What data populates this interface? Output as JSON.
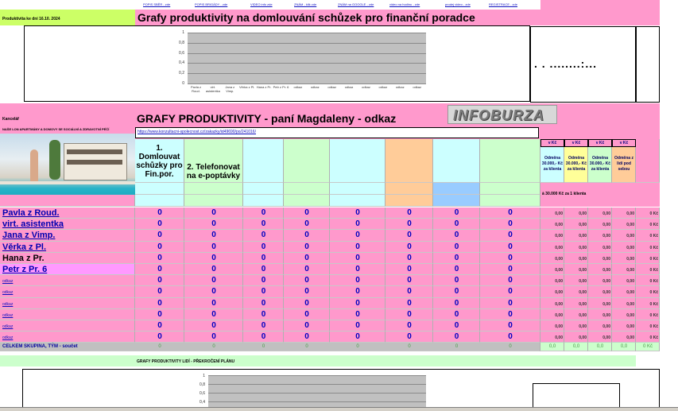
{
  "top_links": [
    "POPIS SBĚR - zde",
    "POPIS BRIGÁDY - zde",
    "VIDEO info zde",
    "ZNÁM - klik zde",
    "ZNÁM na GOOGLE - zde",
    "video na hodinu - zde",
    "prodej video - zde",
    "REGISTRACE - zde"
  ],
  "date_label": "Produktivita ke dni 16.10. 2024",
  "title_top": "Grafy produktivity na domlouvání schůzek pro finanční poradce",
  "top_chart": {
    "y_ticks": [
      "1",
      "0,8",
      "0,6",
      "0,4",
      "0,2",
      "0"
    ],
    "x_labels": [
      "Pavla z Roud.",
      "virt. asistentka",
      "Jana z Vimp.",
      "Věrka z Pl.",
      "Hana z Pr.",
      "Petr z Pr. 6",
      "odkaz",
      "odkaz",
      "odkaz",
      "odkaz",
      "odkaz",
      "odkaz",
      "odkaz",
      "odkaz"
    ]
  },
  "dots_text": ". . ........:...",
  "kancelar_label": "Kancelář",
  "subtitle": "GRAFY  PRODUKTIVITY  - paní Magdaleny - odkaz",
  "logo_text": "INFOBURZA",
  "ad_text": "NAŠE LON APARTMÁNY A DOMOVY SE SOCIÁLNÍ A ZDRAVOTNÍ PÉČÍ",
  "url_text": "https://www.konzultacni-spolecnost.cz/zakazky/id49690/po/241016/",
  "columns": [
    "1. Domlouvat schůzky pro Fin.por.",
    "2. Telefonovat na e-poptávky"
  ],
  "vkc": [
    "v Kč",
    "v Kč",
    "v Kč",
    "v Kč"
  ],
  "odmena": [
    "Odměna 30.000,- Kč za klienta",
    "Odměna 30.000,- Kč za klienta",
    "Odměna 30.000,- Kč za klienta",
    "Odměna z lidí pod sebou"
  ],
  "note_30000": "à 30.000 Kč za 1 klienta",
  "rows": [
    {
      "name": "Pavla z Roud.",
      "vals": [
        "0",
        "0",
        "0",
        "0",
        "0",
        "0",
        "0",
        "0"
      ],
      "money": [
        "0,00",
        "0,00",
        "0,00",
        "0,00",
        "0 Kč"
      ]
    },
    {
      "name": "virt. asistentka",
      "vals": [
        "0",
        "0",
        "0",
        "0",
        "0",
        "0",
        "0",
        "0"
      ],
      "money": [
        "0,00",
        "0,00",
        "0,00",
        "0,00",
        "0 Kč"
      ]
    },
    {
      "name": "Jana z Vimp.",
      "vals": [
        "0",
        "0",
        "0",
        "0",
        "0",
        "0",
        "0",
        "0"
      ],
      "money": [
        "0,00",
        "0,00",
        "0,00",
        "0,00",
        "0 Kč"
      ]
    },
    {
      "name": "Věrka z Pl.",
      "vals": [
        "0",
        "0",
        "0",
        "0",
        "0",
        "0",
        "0",
        "0"
      ],
      "money": [
        "0,00",
        "0,00",
        "0,00",
        "0,00",
        "0 Kč"
      ]
    },
    {
      "name": "Hana z Pr.",
      "vals": [
        "0",
        "0",
        "0",
        "0",
        "0",
        "0",
        "0",
        "0"
      ],
      "money": [
        "0,00",
        "0,00",
        "0,00",
        "0,00",
        "0 Kč"
      ]
    },
    {
      "name": "Petr z Pr. 6",
      "vals": [
        "0",
        "0",
        "0",
        "0",
        "0",
        "0",
        "0",
        "0"
      ],
      "money": [
        "0,00",
        "0,00",
        "0,00",
        "0,00",
        "0 Kč"
      ]
    },
    {
      "name": "odkaz",
      "vals": [
        "0",
        "0",
        "0",
        "0",
        "0",
        "0",
        "0",
        "0"
      ],
      "money": [
        "0,00",
        "0,00",
        "0,00",
        "0,00",
        "0 Kč"
      ]
    },
    {
      "name": "odkaz",
      "vals": [
        "0",
        "0",
        "0",
        "0",
        "0",
        "0",
        "0",
        "0"
      ],
      "money": [
        "0,00",
        "0,00",
        "0,00",
        "0,00",
        "0 Kč"
      ]
    },
    {
      "name": "odkaz",
      "vals": [
        "0",
        "0",
        "0",
        "0",
        "0",
        "0",
        "0",
        "0"
      ],
      "money": [
        "0,00",
        "0,00",
        "0,00",
        "0,00",
        "0 Kč"
      ]
    },
    {
      "name": "odkaz",
      "vals": [
        "0",
        "0",
        "0",
        "0",
        "0",
        "0",
        "0",
        "0"
      ],
      "money": [
        "0,00",
        "0,00",
        "0,00",
        "0,00",
        "0 Kč"
      ]
    },
    {
      "name": "odkaz",
      "vals": [
        "0",
        "0",
        "0",
        "0",
        "0",
        "0",
        "0",
        "0"
      ],
      "money": [
        "0,00",
        "0,00",
        "0,00",
        "0,00",
        "0 Kč"
      ]
    },
    {
      "name": "odkaz",
      "vals": [
        "0",
        "0",
        "0",
        "0",
        "0",
        "0",
        "0",
        "0"
      ],
      "money": [
        "0,00",
        "0,00",
        "0,00",
        "0,00",
        "0 Kč"
      ]
    }
  ],
  "total_label": "CELKEM SKUPINA, TÝM  - součet",
  "total_vals": [
    "0",
    "0",
    "0",
    "0",
    "0",
    "0",
    "0",
    "0"
  ],
  "total_money": [
    "0,0",
    "0,0",
    "0,0",
    "0,0",
    "0 Kč"
  ],
  "bottom_label": "GRAFY  PRODUKTIVITY LIDÍ - PŘEKROČENÍ PLÁNU",
  "bottom_chart": {
    "y_ticks": [
      "1",
      "0,8",
      "0,6",
      "0,4"
    ]
  },
  "colors": {
    "pink": "#ff99cc",
    "green": "#ccffcc",
    "lightblue": "#ccffff",
    "orange": "#ffcc99",
    "blue": "#99ccff",
    "gray": "#c0c0c0",
    "yellow": "#ffff99",
    "lime": "#ccff99"
  }
}
